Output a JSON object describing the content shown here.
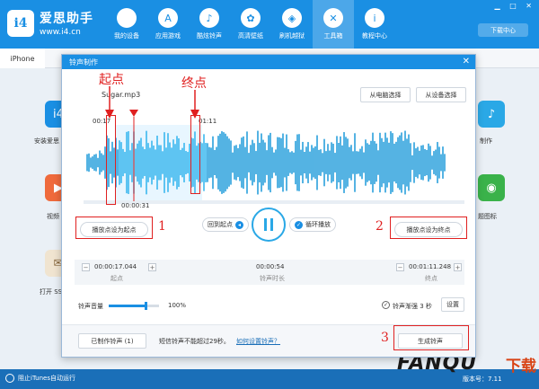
{
  "app": {
    "logo_badge": "i4",
    "name": "爱思助手",
    "url": "www.i4.cn",
    "download_center": "下载中心"
  },
  "nav": [
    {
      "label": "我的设备",
      "icon": "apple-icon",
      "glyph": ""
    },
    {
      "label": "应用游戏",
      "icon": "appstore-icon",
      "glyph": "A"
    },
    {
      "label": "酷炫铃声",
      "icon": "bell-icon",
      "glyph": "♪"
    },
    {
      "label": "高清壁纸",
      "icon": "flower-icon",
      "glyph": "✿"
    },
    {
      "label": "刷机越狱",
      "icon": "box-icon",
      "glyph": "◈"
    },
    {
      "label": "工具箱",
      "icon": "tools-icon",
      "glyph": "✕",
      "active": true
    },
    {
      "label": "教程中心",
      "icon": "info-icon",
      "glyph": "i"
    }
  ],
  "device_tab": "iPhone",
  "background_tiles": {
    "labels": [
      "安装爱思",
      "视频",
      "打开 SS",
      "制作",
      "题图标"
    ]
  },
  "statusbar": {
    "itunes": "阻止iTunes自动运行",
    "version": "版本号：7.11"
  },
  "watermark": {
    "brand": "FANQU",
    "cn": "下载"
  },
  "dialog": {
    "title": "铃声制作",
    "filename": "Sugar.mp3",
    "from_pc": "从电脑选择",
    "from_device": "从设备选择",
    "ts_start": "00:17",
    "ts_end": "01:11",
    "ts_playhead": "00:00:31",
    "set_start_btn": "播放点设为起点",
    "set_end_btn": "播放点设为终点",
    "back_to_start": "回到起点",
    "loop_play": "循环播放",
    "start_time": "00:00:17.044",
    "start_label": "起点",
    "duration": "00:00:54",
    "duration_label": "铃声时长",
    "end_time": "00:01:11.248",
    "end_label": "终点",
    "volume_label": "铃声音量",
    "volume_pct": "100%",
    "volume_value": 0.72,
    "fade_label": "铃声渐强 3 秒",
    "settings_btn": "设置",
    "made_btn": "已制作铃声 (1)",
    "notice": "短信铃声不能超过29秒。",
    "help_link": "如何设置铃声？",
    "generate_btn": "生成铃声"
  },
  "annotations": {
    "start_word": "起点",
    "end_word": "终点",
    "n1": "1",
    "n2": "2",
    "n3": "3"
  },
  "colors": {
    "brand": "#1a8fe3",
    "wave": "#2aa8e6",
    "annotation": "#e02020"
  }
}
